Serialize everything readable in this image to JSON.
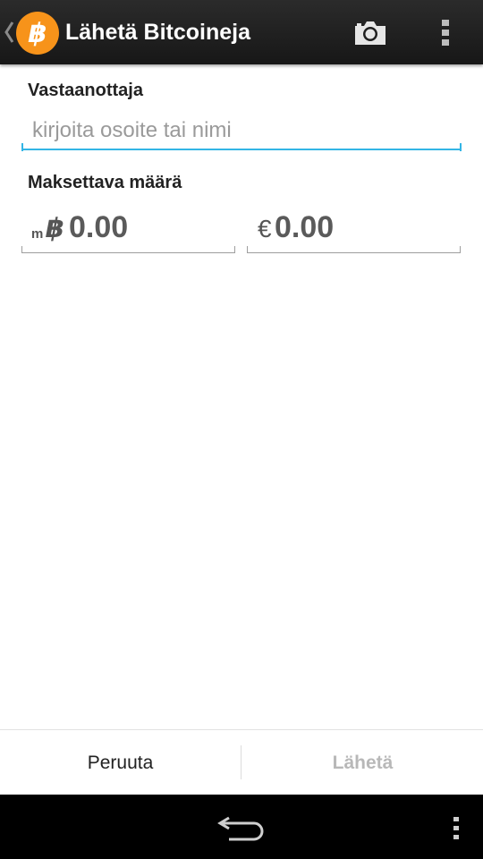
{
  "action_bar": {
    "title": "Lähetä Bitcoineja",
    "logo_icon": "bitcoin-logo-icon",
    "icons": [
      "chevron-left-icon",
      "camera-icon",
      "overflow-menu-icon"
    ],
    "background": "#1f1f1f"
  },
  "form": {
    "recipient_label": "Vastaanottaja",
    "recipient_placeholder": "kirjoita osoite tai nimi",
    "recipient_value": "",
    "amount_label": "Maksettava määrä",
    "btc_prefix_small": "m",
    "btc_prefix_symbol": "฿",
    "btc_value": "0.00",
    "fiat_prefix": "€",
    "fiat_value": "0.00",
    "accent_color": "#33b5e5"
  },
  "buttons": {
    "cancel_label": "Peruuta",
    "send_label": "Lähetä"
  },
  "nav_bar": {
    "icons": [
      "back-icon",
      "menu-icon"
    ]
  }
}
